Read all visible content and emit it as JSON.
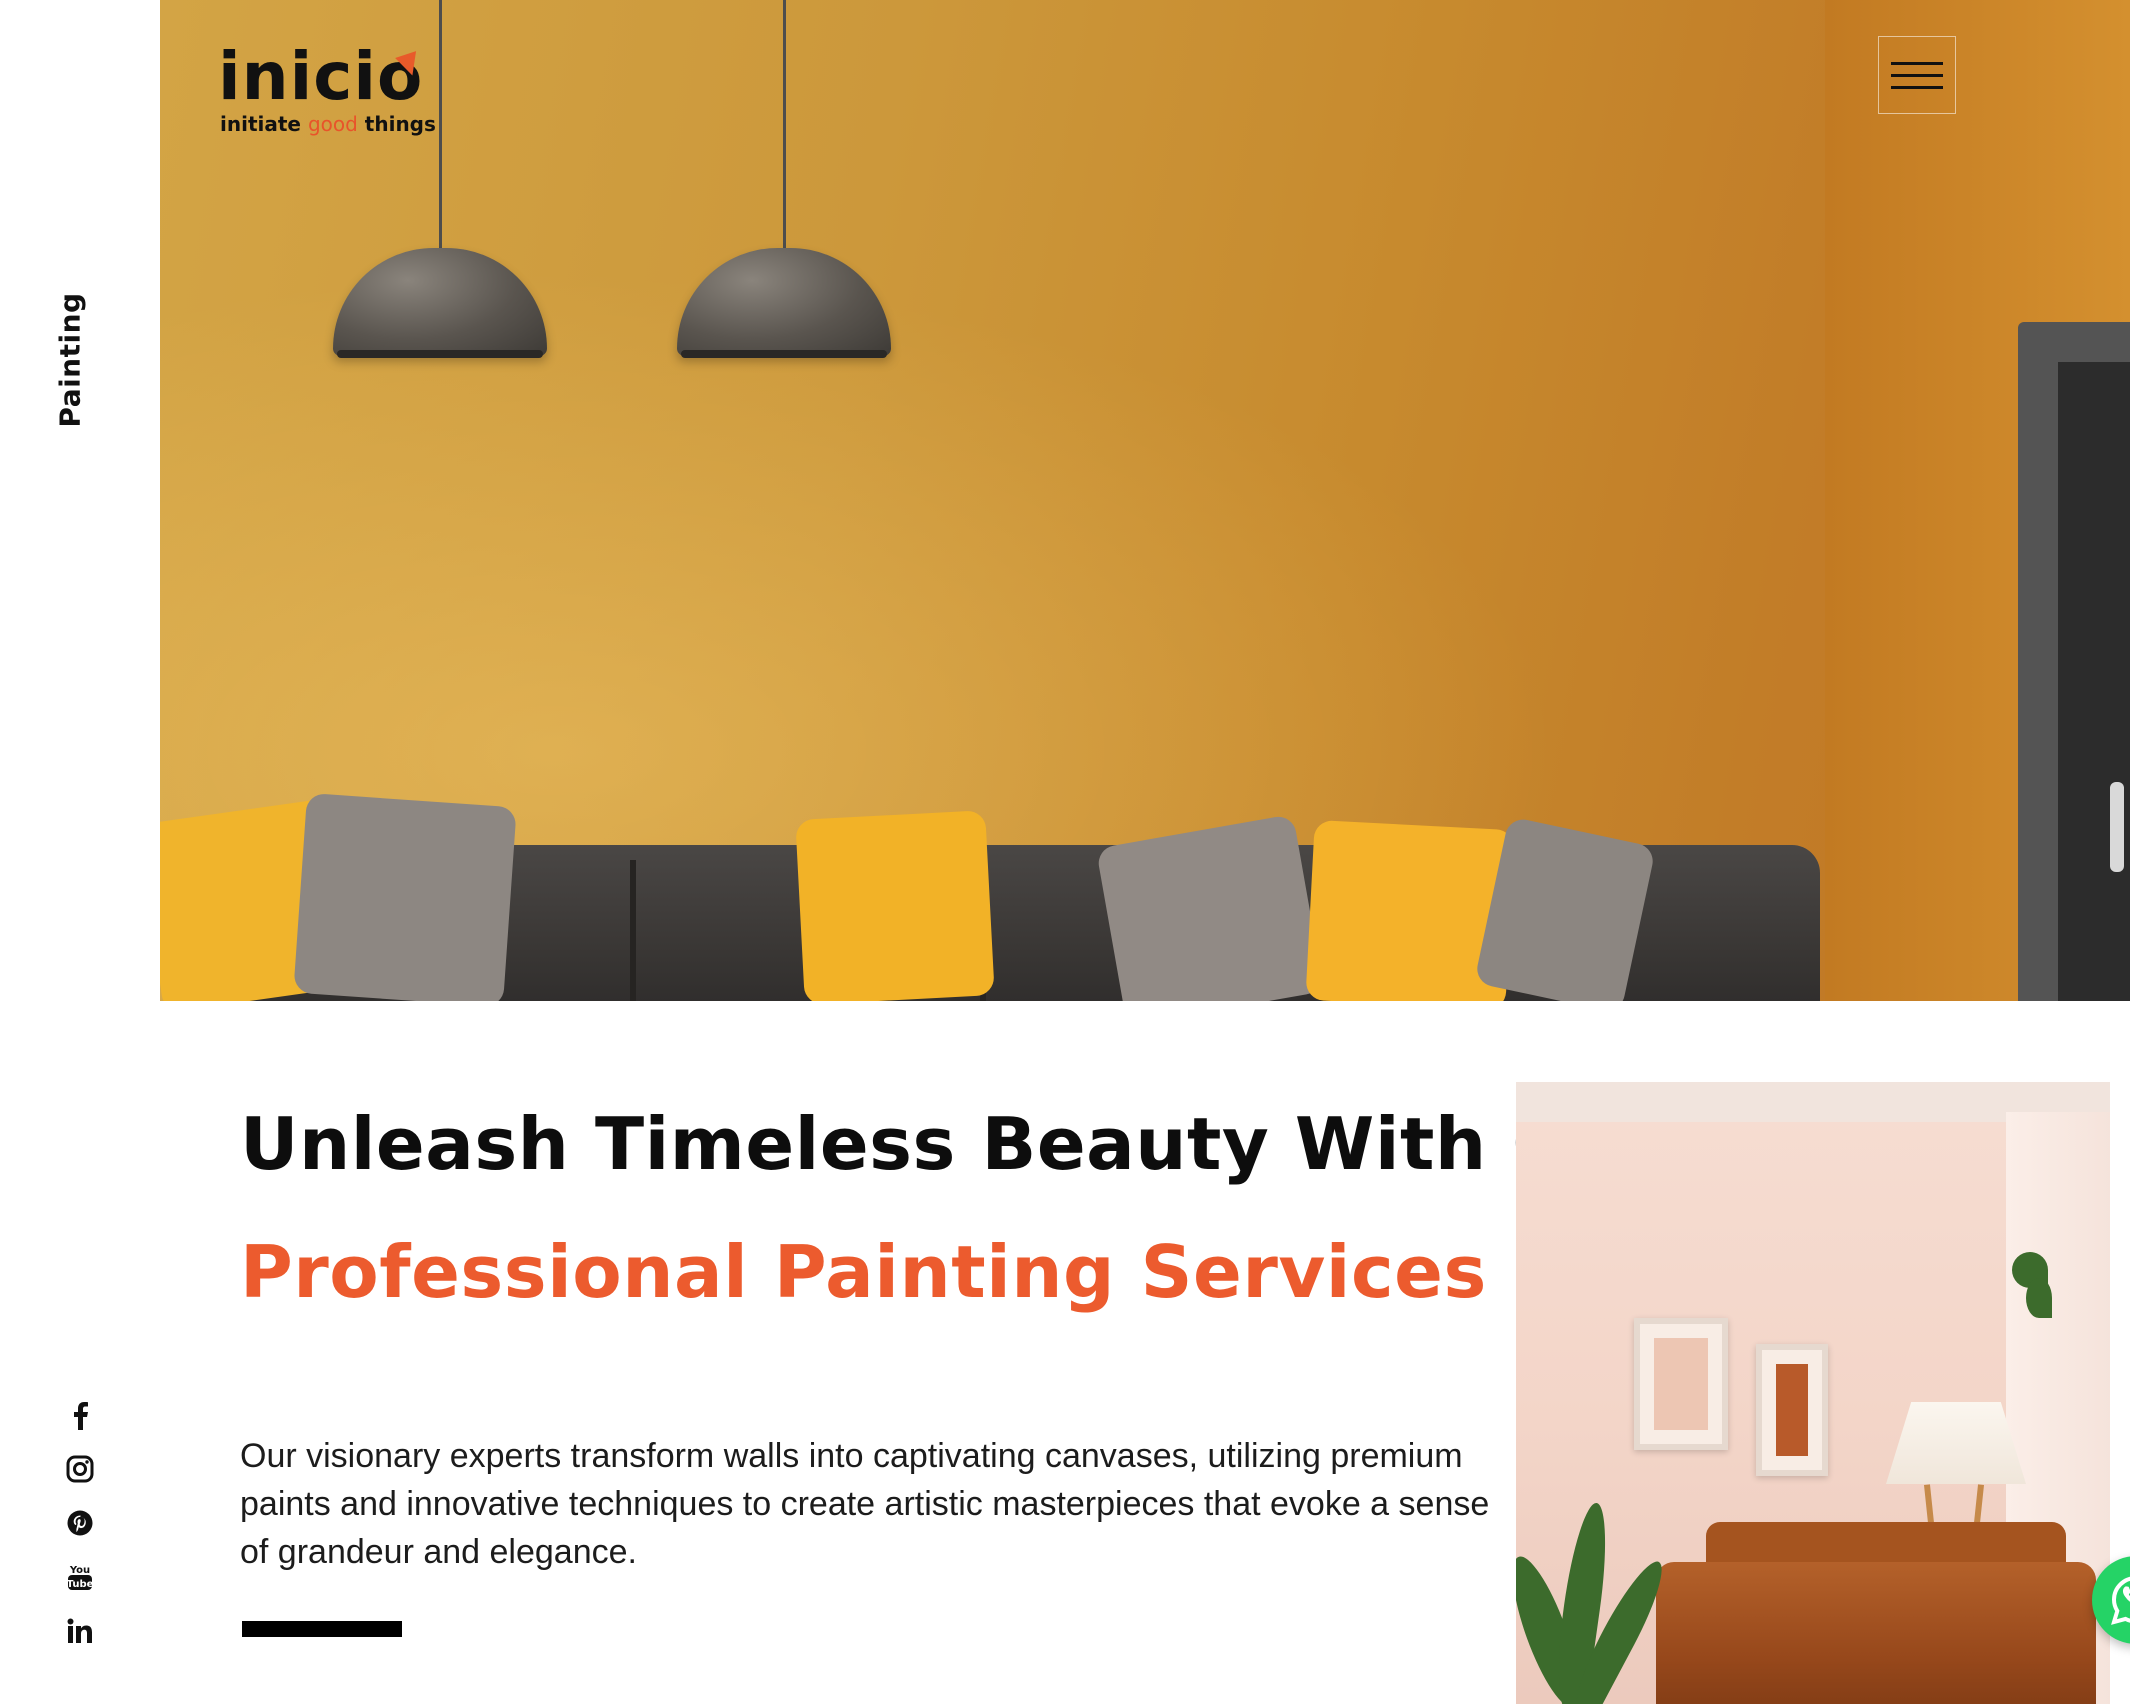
{
  "sidebar": {
    "section_label": "Painting",
    "social": [
      {
        "icon": "facebook-icon"
      },
      {
        "icon": "instagram-icon"
      },
      {
        "icon": "pinterest-icon"
      },
      {
        "icon": "youtube-icon"
      },
      {
        "icon": "linkedin-icon"
      }
    ]
  },
  "header": {
    "logo_text": "inicio",
    "tagline_part1": "initiate ",
    "tagline_accent": "good",
    "tagline_part2": " things",
    "menu_icon": "hamburger-menu-icon"
  },
  "main": {
    "headline_line1": "Unleash Timeless Beauty With Our",
    "headline_line2": "Professional Painting Services",
    "description": "Our visionary experts transform walls into captivating canvases, utilizing premium paints and innovative techniques to create artistic masterpieces that evoke a sense of grandeur and elegance."
  },
  "floating": {
    "whatsapp_icon": "whatsapp-icon"
  },
  "colors": {
    "accent": "#ec5b2e",
    "hero_wall": "#cc963a",
    "text": "#0d0d0d",
    "whatsapp": "#25d366"
  }
}
